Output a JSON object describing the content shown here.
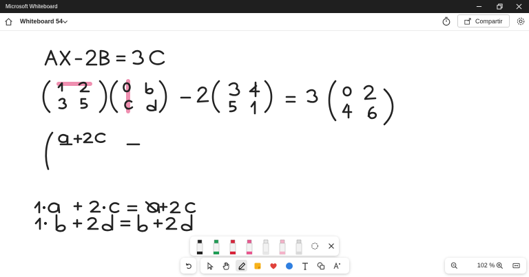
{
  "window": {
    "title": "Microsoft Whiteboard"
  },
  "toolbar": {
    "board_name": "Whiteboard 54",
    "share_label": "Compartir"
  },
  "zoom": {
    "level": "102 %"
  },
  "icons": {
    "home": "home-icon",
    "chevron": "chevron-down-icon",
    "timer": "timer-icon",
    "share": "share-icon",
    "settings": "gear-icon",
    "undo": "undo-icon",
    "select": "select-arrow-icon",
    "pan": "hand-icon",
    "ink": "pen-icon",
    "note": "sticky-note-icon",
    "reactions": "heart-icon",
    "shapes": "shapes-icon",
    "text": "text-icon",
    "more": "more-icon",
    "zoom_out": "zoom-out-icon",
    "zoom_in": "zoom-in-icon",
    "fit": "fit-screen-icon",
    "lasso": "lasso-icon",
    "close": "close-icon"
  },
  "pens": [
    {
      "name": "black-pen",
      "color": "#222222"
    },
    {
      "name": "green-pen",
      "color": "#1f9d55"
    },
    {
      "name": "red-pen",
      "color": "#d8243a"
    },
    {
      "name": "pink-highlighter",
      "color": "#e9578f"
    },
    {
      "name": "white-pen",
      "color": "#e6e6e6"
    },
    {
      "name": "pink-marker",
      "color": "#f4b3c9"
    },
    {
      "name": "ruler",
      "color": "#d9d9d9"
    }
  ],
  "colors": {
    "ink": "#222222",
    "highlight": "#ea6a96",
    "accent": "#0f6cbd"
  }
}
